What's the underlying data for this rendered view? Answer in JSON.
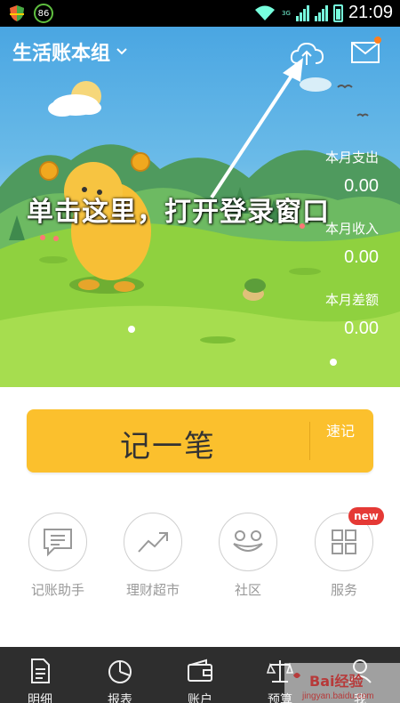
{
  "status_bar": {
    "battery_circle": "86",
    "network": "3G",
    "time": "21:09"
  },
  "header": {
    "book_title": "生活账本组",
    "icons": [
      "chevron-down-icon",
      "cloud-upload-icon",
      "mail-icon"
    ]
  },
  "stats": [
    {
      "label": "本月支出",
      "value": "0.00"
    },
    {
      "label": "本月收入",
      "value": "0.00"
    },
    {
      "label": "本月差额",
      "value": "0.00"
    }
  ],
  "annotation": "单击这里，打开登录窗口",
  "record": {
    "label": "记一笔",
    "quick_label": "速记"
  },
  "features": [
    {
      "label": "记账助手",
      "icon": "chat-doc-icon"
    },
    {
      "label": "理财超市",
      "icon": "trend-up-icon"
    },
    {
      "label": "社区",
      "icon": "smiley-face-icon"
    },
    {
      "label": "服务",
      "icon": "grid-icon",
      "badge": "new"
    }
  ],
  "tabs": [
    {
      "label": "明细",
      "icon": "document-icon"
    },
    {
      "label": "报表",
      "icon": "pie-chart-icon"
    },
    {
      "label": "账户",
      "icon": "wallet-icon"
    },
    {
      "label": "预算",
      "icon": "scale-icon"
    },
    {
      "label": "我",
      "icon": "person-icon"
    }
  ],
  "watermark": {
    "text": "Bai经验",
    "url": "jingyan.baidu.com"
  },
  "colors": {
    "accent_yellow": "#fbc02d",
    "sky_blue": "#4aa6e2",
    "grass_green": "#8fd13f",
    "badge_red": "#e53935",
    "tab_bar": "#2e2e2e"
  }
}
